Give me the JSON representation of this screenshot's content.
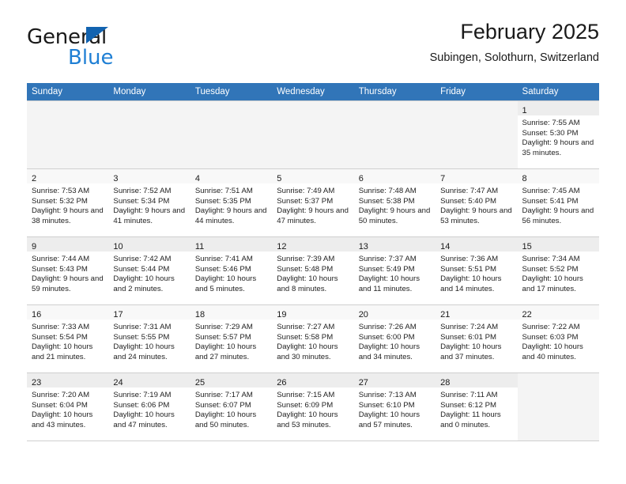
{
  "brand": {
    "name_top": "General",
    "name_bottom": "Blue",
    "accent_color": "#1f7fd4",
    "triangle_color": "#1263b0"
  },
  "header": {
    "title": "February 2025",
    "subtitle": "Subingen, Solothurn, Switzerland",
    "header_bar_color": "#3175b8",
    "header_text_color": "#ffffff"
  },
  "weekdays": [
    "Sunday",
    "Monday",
    "Tuesday",
    "Wednesday",
    "Thursday",
    "Friday",
    "Saturday"
  ],
  "labels": {
    "sunrise_prefix": "Sunrise: ",
    "sunset_prefix": "Sunset: ",
    "daylight_prefix": "Daylight: "
  },
  "weeks": [
    [
      {
        "empty": true
      },
      {
        "empty": true
      },
      {
        "empty": true
      },
      {
        "empty": true
      },
      {
        "empty": true
      },
      {
        "empty": true
      },
      {
        "day": "1",
        "sunrise": "Sunrise: 7:55 AM",
        "sunset": "Sunset: 5:30 PM",
        "daylight": "Daylight: 9 hours and 35 minutes."
      }
    ],
    [
      {
        "day": "2",
        "sunrise": "Sunrise: 7:53 AM",
        "sunset": "Sunset: 5:32 PM",
        "daylight": "Daylight: 9 hours and 38 minutes."
      },
      {
        "day": "3",
        "sunrise": "Sunrise: 7:52 AM",
        "sunset": "Sunset: 5:34 PM",
        "daylight": "Daylight: 9 hours and 41 minutes."
      },
      {
        "day": "4",
        "sunrise": "Sunrise: 7:51 AM",
        "sunset": "Sunset: 5:35 PM",
        "daylight": "Daylight: 9 hours and 44 minutes."
      },
      {
        "day": "5",
        "sunrise": "Sunrise: 7:49 AM",
        "sunset": "Sunset: 5:37 PM",
        "daylight": "Daylight: 9 hours and 47 minutes."
      },
      {
        "day": "6",
        "sunrise": "Sunrise: 7:48 AM",
        "sunset": "Sunset: 5:38 PM",
        "daylight": "Daylight: 9 hours and 50 minutes."
      },
      {
        "day": "7",
        "sunrise": "Sunrise: 7:47 AM",
        "sunset": "Sunset: 5:40 PM",
        "daylight": "Daylight: 9 hours and 53 minutes."
      },
      {
        "day": "8",
        "sunrise": "Sunrise: 7:45 AM",
        "sunset": "Sunset: 5:41 PM",
        "daylight": "Daylight: 9 hours and 56 minutes."
      }
    ],
    [
      {
        "day": "9",
        "sunrise": "Sunrise: 7:44 AM",
        "sunset": "Sunset: 5:43 PM",
        "daylight": "Daylight: 9 hours and 59 minutes."
      },
      {
        "day": "10",
        "sunrise": "Sunrise: 7:42 AM",
        "sunset": "Sunset: 5:44 PM",
        "daylight": "Daylight: 10 hours and 2 minutes."
      },
      {
        "day": "11",
        "sunrise": "Sunrise: 7:41 AM",
        "sunset": "Sunset: 5:46 PM",
        "daylight": "Daylight: 10 hours and 5 minutes."
      },
      {
        "day": "12",
        "sunrise": "Sunrise: 7:39 AM",
        "sunset": "Sunset: 5:48 PM",
        "daylight": "Daylight: 10 hours and 8 minutes."
      },
      {
        "day": "13",
        "sunrise": "Sunrise: 7:37 AM",
        "sunset": "Sunset: 5:49 PM",
        "daylight": "Daylight: 10 hours and 11 minutes."
      },
      {
        "day": "14",
        "sunrise": "Sunrise: 7:36 AM",
        "sunset": "Sunset: 5:51 PM",
        "daylight": "Daylight: 10 hours and 14 minutes."
      },
      {
        "day": "15",
        "sunrise": "Sunrise: 7:34 AM",
        "sunset": "Sunset: 5:52 PM",
        "daylight": "Daylight: 10 hours and 17 minutes."
      }
    ],
    [
      {
        "day": "16",
        "sunrise": "Sunrise: 7:33 AM",
        "sunset": "Sunset: 5:54 PM",
        "daylight": "Daylight: 10 hours and 21 minutes."
      },
      {
        "day": "17",
        "sunrise": "Sunrise: 7:31 AM",
        "sunset": "Sunset: 5:55 PM",
        "daylight": "Daylight: 10 hours and 24 minutes."
      },
      {
        "day": "18",
        "sunrise": "Sunrise: 7:29 AM",
        "sunset": "Sunset: 5:57 PM",
        "daylight": "Daylight: 10 hours and 27 minutes."
      },
      {
        "day": "19",
        "sunrise": "Sunrise: 7:27 AM",
        "sunset": "Sunset: 5:58 PM",
        "daylight": "Daylight: 10 hours and 30 minutes."
      },
      {
        "day": "20",
        "sunrise": "Sunrise: 7:26 AM",
        "sunset": "Sunset: 6:00 PM",
        "daylight": "Daylight: 10 hours and 34 minutes."
      },
      {
        "day": "21",
        "sunrise": "Sunrise: 7:24 AM",
        "sunset": "Sunset: 6:01 PM",
        "daylight": "Daylight: 10 hours and 37 minutes."
      },
      {
        "day": "22",
        "sunrise": "Sunrise: 7:22 AM",
        "sunset": "Sunset: 6:03 PM",
        "daylight": "Daylight: 10 hours and 40 minutes."
      }
    ],
    [
      {
        "day": "23",
        "sunrise": "Sunrise: 7:20 AM",
        "sunset": "Sunset: 6:04 PM",
        "daylight": "Daylight: 10 hours and 43 minutes."
      },
      {
        "day": "24",
        "sunrise": "Sunrise: 7:19 AM",
        "sunset": "Sunset: 6:06 PM",
        "daylight": "Daylight: 10 hours and 47 minutes."
      },
      {
        "day": "25",
        "sunrise": "Sunrise: 7:17 AM",
        "sunset": "Sunset: 6:07 PM",
        "daylight": "Daylight: 10 hours and 50 minutes."
      },
      {
        "day": "26",
        "sunrise": "Sunrise: 7:15 AM",
        "sunset": "Sunset: 6:09 PM",
        "daylight": "Daylight: 10 hours and 53 minutes."
      },
      {
        "day": "27",
        "sunrise": "Sunrise: 7:13 AM",
        "sunset": "Sunset: 6:10 PM",
        "daylight": "Daylight: 10 hours and 57 minutes."
      },
      {
        "day": "28",
        "sunrise": "Sunrise: 7:11 AM",
        "sunset": "Sunset: 6:12 PM",
        "daylight": "Daylight: 11 hours and 0 minutes."
      },
      {
        "empty": true
      }
    ]
  ]
}
